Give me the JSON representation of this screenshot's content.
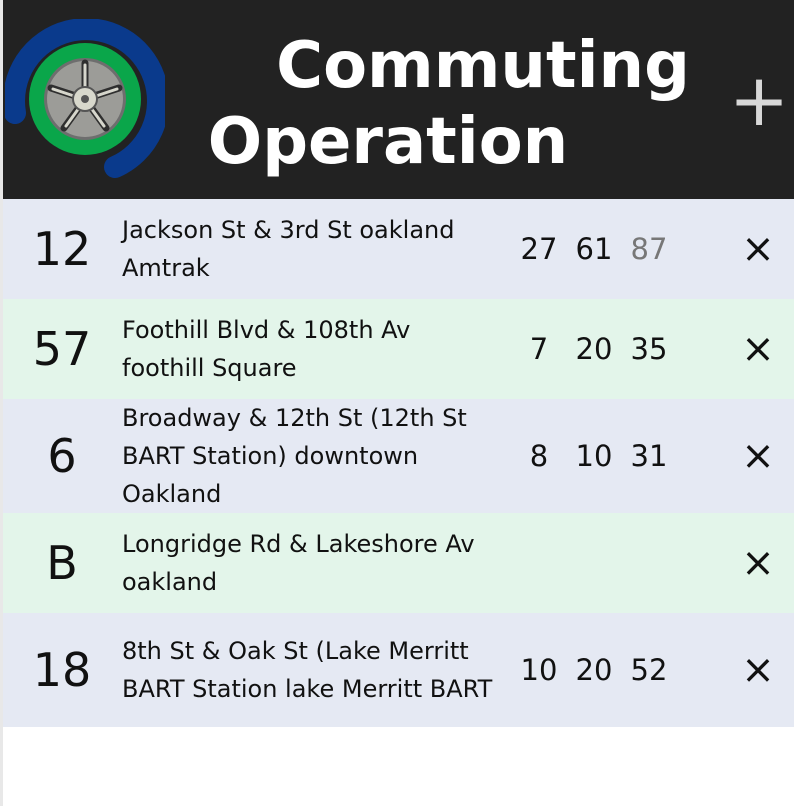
{
  "header": {
    "title_line1": "Commuting",
    "title_line2": "Operation",
    "add_label": "+"
  },
  "rows": [
    {
      "route": "12",
      "stop": "Jackson St & 3rd St oakland Amtrak",
      "times": [
        "27",
        "61",
        "87"
      ],
      "faded_last": true,
      "delete_label": "×",
      "bg": "blue"
    },
    {
      "route": "57",
      "stop": "Foothill Blvd & 108th Av foothill Square",
      "times": [
        "7",
        "20",
        "35"
      ],
      "faded_last": false,
      "delete_label": "×",
      "bg": "green"
    },
    {
      "route": "6",
      "stop": "Broadway & 12th St (12th St BART Station) downtown Oakland",
      "times": [
        "8",
        "10",
        "31"
      ],
      "faded_last": false,
      "delete_label": "×",
      "bg": "blue"
    },
    {
      "route": "B",
      "stop": "Longridge Rd & Lakeshore Av oakland",
      "times": [],
      "faded_last": false,
      "delete_label": "×",
      "bg": "green"
    },
    {
      "route": "18",
      "stop": "8th St & Oak St (Lake Merritt BART Station lake Merritt BART",
      "times": [
        "10",
        "20",
        "52"
      ],
      "faded_last": false,
      "delete_label": "×",
      "bg": "blue"
    }
  ],
  "colors": {
    "header_bg": "#222222",
    "row_blue": "#e5e9f3",
    "row_green": "#e3f5ea",
    "logo_blue": "#0a3a8c",
    "logo_green": "#0aa64a",
    "faded_time": "#777777"
  },
  "icons": {
    "logo": "wheel-logo-icon",
    "add": "plus-icon",
    "delete": "close-icon"
  }
}
